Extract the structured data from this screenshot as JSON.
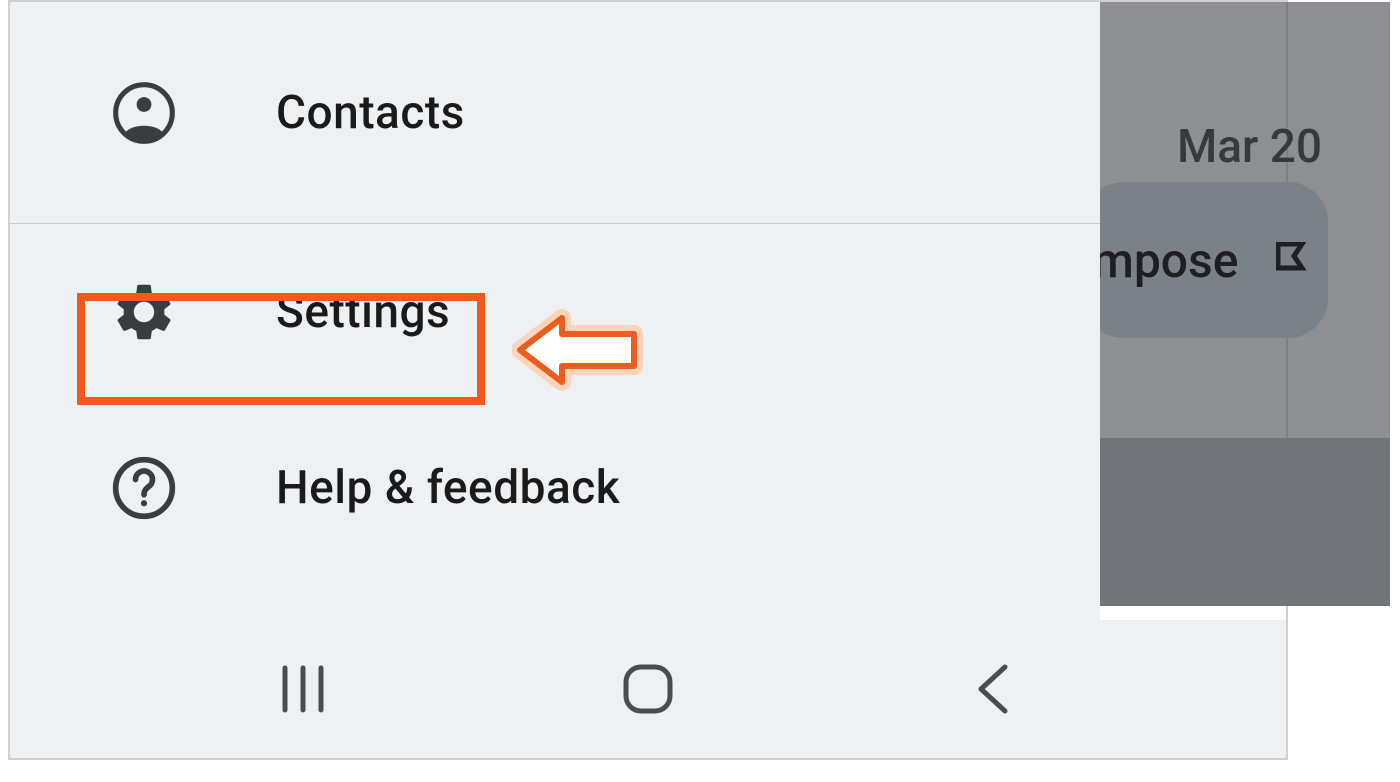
{
  "sidebar": {
    "items": [
      {
        "label": "Contacts",
        "icon": "person-circle-icon"
      },
      {
        "label": "Settings",
        "icon": "gear-icon",
        "highlighted": true
      },
      {
        "label": "Help & feedback",
        "icon": "help-circle-icon"
      }
    ]
  },
  "background": {
    "date": "Mar 20",
    "compose_label": "mpose"
  },
  "annotation": {
    "highlight_color": "#ed5b1e",
    "arrow_color": "#f4925a"
  }
}
